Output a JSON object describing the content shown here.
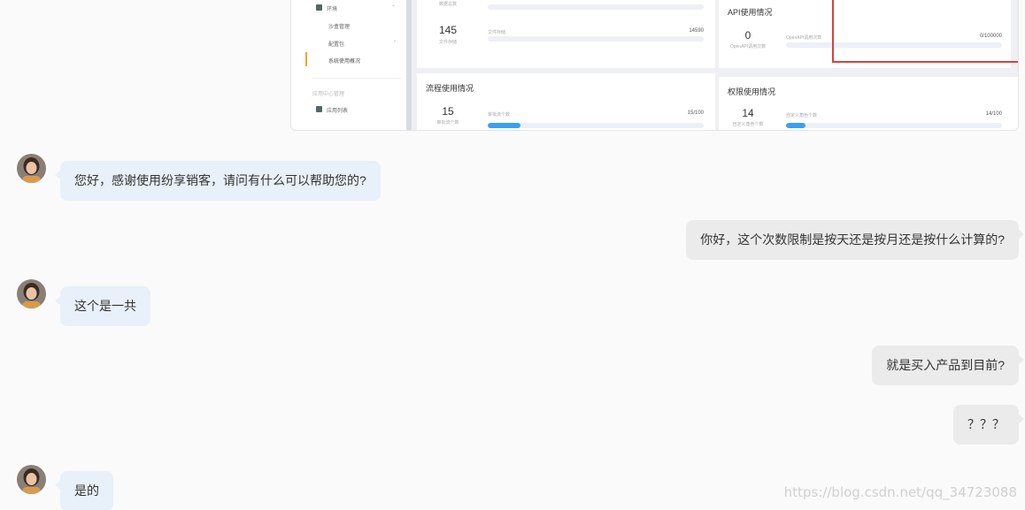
{
  "screenshot": {
    "sidebar": {
      "env_label": "环境",
      "items": [
        "沙盒管理",
        "配置包",
        "系统使用概况"
      ],
      "group_label": "应用中心管理",
      "app_list_label": "应用列表"
    },
    "top_left_card": {
      "sub_top": "数据总数",
      "number": "145",
      "number_sub": "文件存储",
      "bar_label": "文件存储",
      "bar_count": "14590",
      "bar_fill": 0.0
    },
    "api_card": {
      "title": "API使用情况",
      "number": "0",
      "number_sub": "OpenAPI调用次数",
      "bar_label": "OpenAPI调用次数",
      "bar_count": "0/100000",
      "bar_fill": 0.0
    },
    "flow_card": {
      "title": "流程使用情况",
      "number": "15",
      "number_sub": "审批流个数",
      "bar_label": "审批流个数",
      "bar_count": "15/100",
      "bar_fill": 0.15
    },
    "perm_card": {
      "title": "权限使用情况",
      "number": "14",
      "number_sub": "自定义角色个数",
      "bar_label": "自定义角色个数",
      "bar_count": "14/100",
      "bar_fill": 0.09
    }
  },
  "messages": [
    {
      "side": "in",
      "text": "您好，感谢使用纷享销客，请问有什么可以帮助您的?"
    },
    {
      "side": "out",
      "text": "你好，这个次数限制是按天还是按月还是按什么计算的?"
    },
    {
      "side": "in",
      "text": "这个是一共"
    },
    {
      "side": "out",
      "text": "就是买入产品到目前?"
    },
    {
      "side": "out",
      "text": "？？？"
    },
    {
      "side": "in",
      "text": "是的"
    }
  ],
  "watermark": "https://blog.csdn.net/qq_34723088"
}
